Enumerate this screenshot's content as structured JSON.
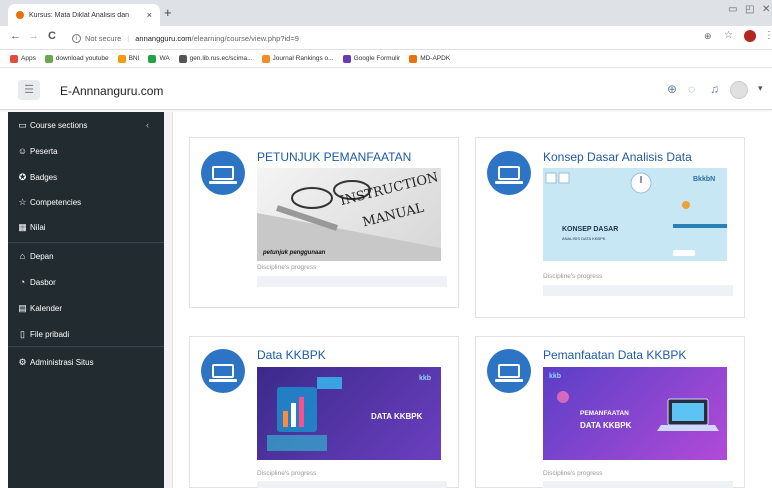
{
  "browser": {
    "tab_title": "Kursus: Mata Diklat Analisis dan",
    "tab_close": "×",
    "new_tab": "+",
    "back": "←",
    "forward": "→",
    "reload": "C",
    "info_icon": "i",
    "security_label": "Not secure",
    "url_host": "annangguru.com",
    "url_path": "/elearning/course/view.php?id=9",
    "bookmarks": [
      {
        "label": "Apps",
        "color": "#e24a3b"
      },
      {
        "label": "download youtube",
        "color": "#6aa84f"
      },
      {
        "label": "BNI",
        "color": "#f39c12"
      },
      {
        "label": "WA",
        "color": "#25a244"
      },
      {
        "label": "gen.lib.rus.ec/scima...",
        "color": "#555555"
      },
      {
        "label": "Journal Rankings o...",
        "color": "#f28c28"
      },
      {
        "label": "Google Formulir",
        "color": "#673ab7"
      },
      {
        "label": "MD-APDK",
        "color": "#e8710a"
      }
    ]
  },
  "header": {
    "brand": "E-Annnanguru.com",
    "menu_icon": "☰"
  },
  "sidebar": {
    "collapse": "‹",
    "items": [
      {
        "icon": "folder-icon",
        "glyph": "▭",
        "label": "Course sections"
      },
      {
        "icon": "users-icon",
        "glyph": "☺",
        "label": "Peserta"
      },
      {
        "icon": "badge-icon",
        "glyph": "✪",
        "label": "Badges"
      },
      {
        "icon": "star-icon",
        "glyph": "☆",
        "label": "Competencies"
      },
      {
        "icon": "grades-icon",
        "glyph": "▦",
        "label": "Nilai"
      },
      {
        "icon": "home-icon",
        "glyph": "⌂",
        "label": "Depan"
      },
      {
        "icon": "dashboard-icon",
        "glyph": "◔",
        "label": "Dasbor"
      },
      {
        "icon": "calendar-icon",
        "glyph": "▤",
        "label": "Kalender"
      },
      {
        "icon": "file-icon",
        "glyph": "▯",
        "label": "File pribadi"
      },
      {
        "icon": "gear-icon",
        "glyph": "⚙",
        "label": "Administrasi Situs"
      }
    ]
  },
  "cards": [
    {
      "title": "PETUNJUK PEMANFAATAN",
      "progress_label": "Discipline's progress",
      "image_text": [
        "INSTRUCTION",
        "MANUAL"
      ],
      "image_caption": "petunjuk penggunaan"
    },
    {
      "title": "Konsep Dasar Analisis Data",
      "progress_label": "Discipline's progress",
      "image_text": [
        "KONSEP DASAR",
        "ANALISIS DATA KKBPK"
      ],
      "image_logo": "BkkbN"
    },
    {
      "title": "Data KKBPK",
      "progress_label": "Discipline's progress",
      "image_text": [
        "DATA KKBPK"
      ],
      "image_logo": "kkb"
    },
    {
      "title": "Pemanfaatan Data KKBPK",
      "progress_label": "Discipline's progress",
      "image_text": [
        "PEMANFAATAN",
        "DATA KKBPK"
      ],
      "image_logo": "kkb"
    }
  ]
}
